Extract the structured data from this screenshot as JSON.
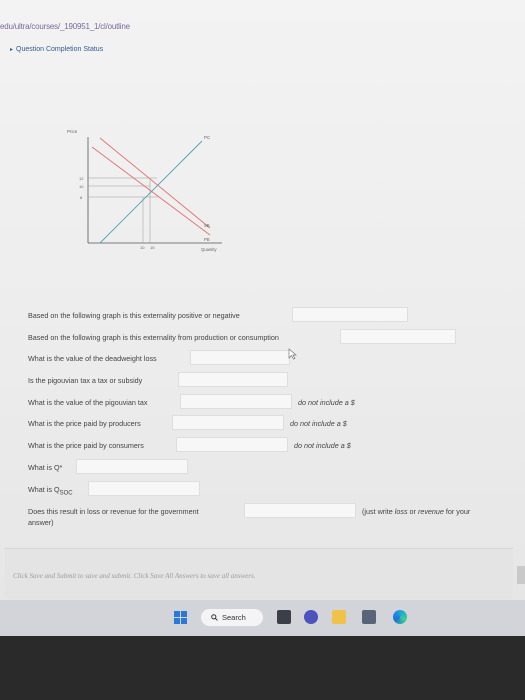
{
  "browser": {
    "url": "edu/ultra/courses/_190951_1/cl/outline"
  },
  "section": {
    "toggle_icon": "triangle-icon",
    "label": "Question Completion Status"
  },
  "graph": {
    "y_axis_label": "Price",
    "x_axis_label": "Quantity",
    "curve_labels": {
      "pc": "PC",
      "sb": "SB",
      "pb": "PB"
    },
    "y_ticks": [
      "12",
      "10",
      "8"
    ],
    "x_ticks": [
      "10",
      "15"
    ]
  },
  "questions": [
    {
      "id": "q1",
      "text": "Based on the following graph is this externality positive or negative",
      "answer": "",
      "note": ""
    },
    {
      "id": "q2",
      "text": "Based on the following graph is this externality from production or consumption",
      "answer": "",
      "note": ""
    },
    {
      "id": "q3",
      "text": "What is the value of the deadweight loss",
      "answer": "",
      "note": ""
    },
    {
      "id": "q4",
      "text": "Is the pigouvian tax a tax or subsidy",
      "answer": "",
      "note": ""
    },
    {
      "id": "q5",
      "text": "What is the value of the pigouvian tax",
      "answer": "",
      "note": "do not include a $"
    },
    {
      "id": "q6",
      "text": "What is the price paid by producers",
      "answer": "",
      "note": "do not include a $"
    },
    {
      "id": "q7",
      "text": "What is the price paid by consumers",
      "answer": "",
      "note": "do not include a $"
    },
    {
      "id": "q8",
      "text": "What is Q*",
      "answer": "",
      "note": ""
    },
    {
      "id": "q9",
      "text_prefix": "What is Q",
      "text_sub": "SOC",
      "answer": "",
      "note": ""
    },
    {
      "id": "q10",
      "text": "Does this result in loss or revenue for the government",
      "answer": "",
      "note_prefix": "(just write ",
      "note_italic": "loss",
      "note_mid": " or ",
      "note_italic2": "revenue",
      "note_suffix": " for your",
      "note_line2": "answer)"
    }
  ],
  "footer": {
    "submit_text": "Click Save and Submit to save and submit. Click Save All Answers to save all answers."
  },
  "taskbar": {
    "search_label": "Search",
    "search_icon": "search-icon",
    "icons": [
      "windows-start-icon",
      "file-explorer-icon",
      "teams-chat-icon",
      "folder-icon",
      "store-icon",
      "edge-icon"
    ]
  },
  "colors": {
    "supply_private": "#4fa3b8",
    "supply_social": "#e07070",
    "demand": "#e07070",
    "link": "#2f5d8f"
  }
}
